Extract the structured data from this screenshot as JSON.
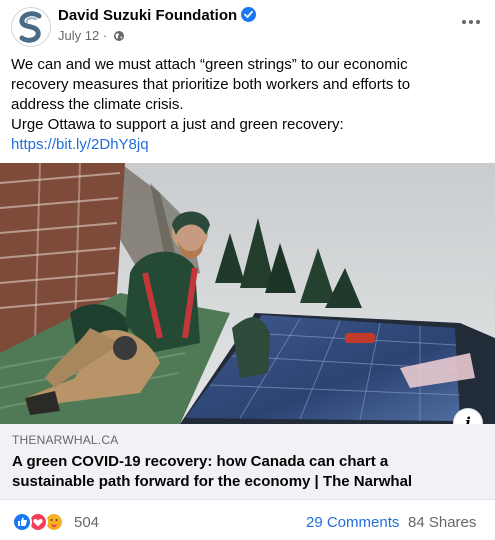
{
  "post": {
    "page_name": "David Suzuki Foundation",
    "date": "July 12",
    "separator": "·",
    "text_lines": [
      "We can and we must attach “green strings” to our economic",
      "recovery measures that prioritize both workers and efforts to",
      "address the climate crisis.",
      "Urge Ottawa to support a just and green recovery:"
    ],
    "link_text": "https://bit.ly/2DhY8jq"
  },
  "link_preview": {
    "domain": "THENARWHAL.CA",
    "title_line_1": "A green COVID-19 recovery: how Canada can chart a",
    "title_line_2": "sustainable path forward for the economy | The Narwhal",
    "info_label": "i"
  },
  "engagement": {
    "reaction_count": "504",
    "comments": "29 Comments",
    "shares": "84 Shares"
  },
  "icons": [
    "verified-badge-icon",
    "globe-icon",
    "more-options-icon",
    "like-reaction-icon",
    "love-reaction-icon",
    "care-reaction-icon",
    "info-icon"
  ],
  "colors": {
    "link_blue": "#216fdb",
    "verified_blue": "#1877f2",
    "love_red": "#f33e58",
    "care_yellow": "#f7b125",
    "card_background": "#f0f2f5"
  }
}
